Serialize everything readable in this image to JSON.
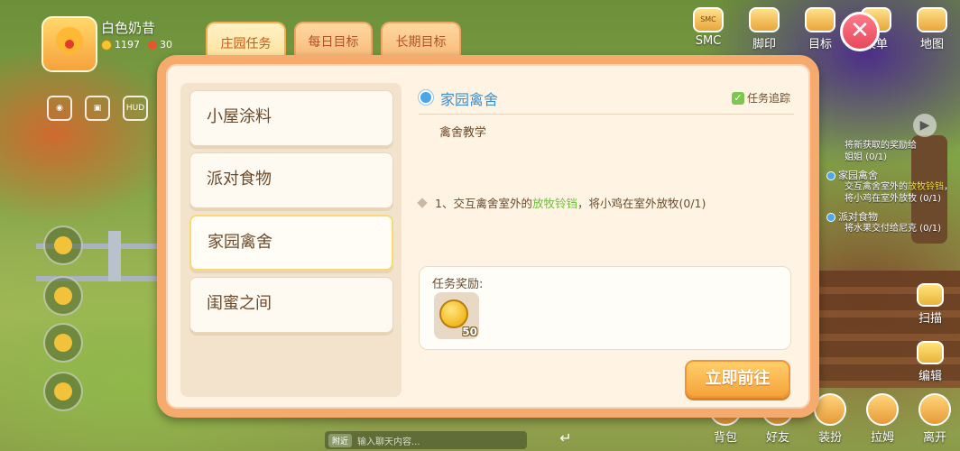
{
  "player": {
    "name": "白色奶昔",
    "coins": "1197",
    "gems": "30"
  },
  "hud": {
    "hud_label": "HUD"
  },
  "top_menu": [
    {
      "label": "SMC",
      "icon": "smc-icon",
      "badge": "SMC"
    },
    {
      "label": "脚印",
      "icon": "footprint-icon"
    },
    {
      "label": "目标",
      "icon": "target-book-icon"
    },
    {
      "label": "菜单",
      "icon": "menu-icon"
    },
    {
      "label": "地图",
      "icon": "map-icon"
    }
  ],
  "close_button": {
    "label": "✕"
  },
  "tabs": [
    {
      "label": "庄园任务",
      "active": true
    },
    {
      "label": "每日目标",
      "active": false
    },
    {
      "label": "长期目标",
      "active": false
    }
  ],
  "tasks": [
    {
      "label": "小屋涂料",
      "selected": false
    },
    {
      "label": "派对食物",
      "selected": false
    },
    {
      "label": "家园禽舍",
      "selected": true
    },
    {
      "label": "闺蜜之间",
      "selected": false
    }
  ],
  "detail": {
    "title": "家园禽舍",
    "track_label": "任务追踪",
    "description": "禽舍教学",
    "objective": {
      "prefix": "1、交互禽舍室外的",
      "highlight": "放牧铃铛",
      "suffix": "，将小鸡在室外放牧(0/1)"
    },
    "reward_label": "任务奖励:",
    "reward": {
      "item": "coin",
      "quantity": "50"
    },
    "go_button": "立即前往"
  },
  "tracker": {
    "partial_line": "将新获取的奖励给",
    "partial_line2": "姐姐 (0/1)",
    "items": [
      {
        "title": "家园禽舍",
        "body_prefix": "交互禽舍室外的",
        "body_highlight": "放牧铃铛",
        "body_suffix": "，将小鸡在室外放牧 (0/1)"
      },
      {
        "title": "派对食物",
        "body": "将水果交付给尼克 (0/1)"
      }
    ]
  },
  "side_actions": [
    {
      "label": "扫描",
      "icon": "scan-icon"
    },
    {
      "label": "编辑",
      "icon": "edit-icon"
    }
  ],
  "bottom_menu": [
    {
      "label": "背包",
      "icon": "backpack-icon"
    },
    {
      "label": "好友",
      "icon": "friends-icon"
    },
    {
      "label": "装扮",
      "icon": "dressup-icon"
    },
    {
      "label": "拉姆",
      "icon": "lamu-icon"
    },
    {
      "label": "离开",
      "icon": "leave-home-icon"
    }
  ],
  "chat": {
    "tag": "附近",
    "placeholder": "输入聊天内容..."
  },
  "colors": {
    "dialog_border": "#f7aa6e",
    "dialog_bg": "#fff3e3",
    "title_blue": "#3f8fcd",
    "highlight_green": "#6fbe3b",
    "go_button": "#f6a33b"
  }
}
